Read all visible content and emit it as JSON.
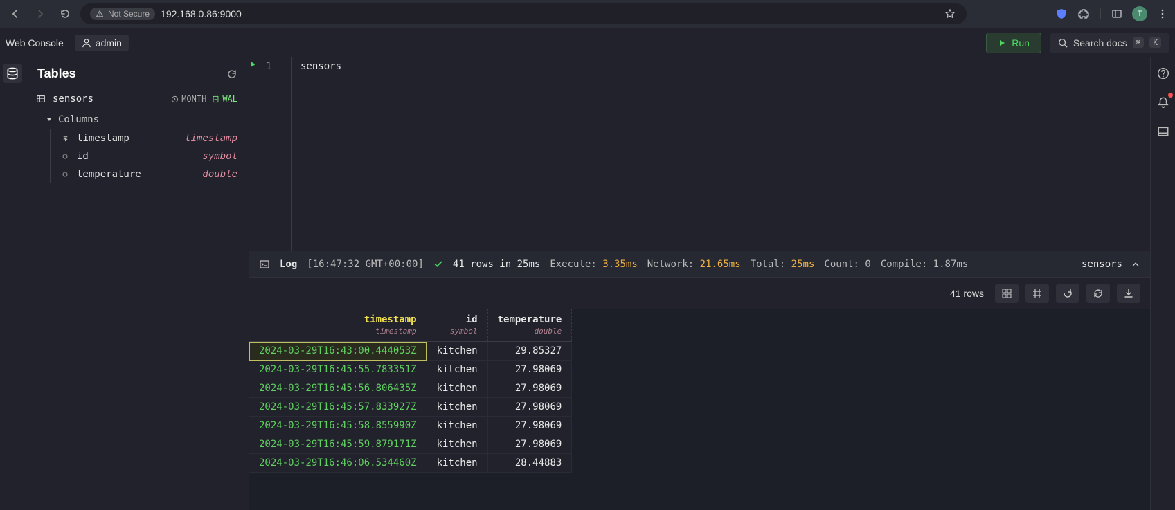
{
  "browser": {
    "not_secure_label": "Not Secure",
    "url": "192.168.0.86:9000",
    "avatar_initial": "T"
  },
  "app_header": {
    "web_console": "Web Console",
    "admin": "admin",
    "run_label": "Run",
    "search_docs_label": "Search docs",
    "kbd1": "⌘",
    "kbd2": "K"
  },
  "sidebar": {
    "title": "Tables",
    "table": {
      "name": "sensors",
      "partition_label": "MONTH",
      "wal_label": "WAL",
      "columns_label": "Columns",
      "columns": [
        {
          "name": "timestamp",
          "type": "timestamp",
          "designated": true
        },
        {
          "name": "id",
          "type": "symbol",
          "designated": false
        },
        {
          "name": "temperature",
          "type": "double",
          "designated": false
        }
      ]
    }
  },
  "editor": {
    "line_number": "1",
    "code": "sensors"
  },
  "log": {
    "label": "Log",
    "timestamp": "[16:47:32 GMT+00:00]",
    "summary": "41 rows in 25ms",
    "execute_label": "Execute:",
    "execute_val": "3.35ms",
    "network_label": "Network:",
    "network_val": "21.65ms",
    "total_label": "Total:",
    "total_val": "25ms",
    "count_label": "Count: 0",
    "compile_label": "Compile: 1.87ms",
    "query_name": "sensors"
  },
  "results_bar": {
    "rows_label": "41 rows"
  },
  "grid": {
    "headers": [
      {
        "name": "timestamp",
        "type": "timestamp",
        "active": true
      },
      {
        "name": "id",
        "type": "symbol",
        "active": false
      },
      {
        "name": "temperature",
        "type": "double",
        "active": false
      }
    ],
    "rows": [
      {
        "timestamp": "2024-03-29T16:43:00.444053Z",
        "id": "kitchen",
        "temperature": "29.85327",
        "selected": true
      },
      {
        "timestamp": "2024-03-29T16:45:55.783351Z",
        "id": "kitchen",
        "temperature": "27.98069",
        "selected": false
      },
      {
        "timestamp": "2024-03-29T16:45:56.806435Z",
        "id": "kitchen",
        "temperature": "27.98069",
        "selected": false
      },
      {
        "timestamp": "2024-03-29T16:45:57.833927Z",
        "id": "kitchen",
        "temperature": "27.98069",
        "selected": false
      },
      {
        "timestamp": "2024-03-29T16:45:58.855990Z",
        "id": "kitchen",
        "temperature": "27.98069",
        "selected": false
      },
      {
        "timestamp": "2024-03-29T16:45:59.879171Z",
        "id": "kitchen",
        "temperature": "27.98069",
        "selected": false
      },
      {
        "timestamp": "2024-03-29T16:46:06.534460Z",
        "id": "kitchen",
        "temperature": "28.44883",
        "selected": false
      }
    ]
  }
}
